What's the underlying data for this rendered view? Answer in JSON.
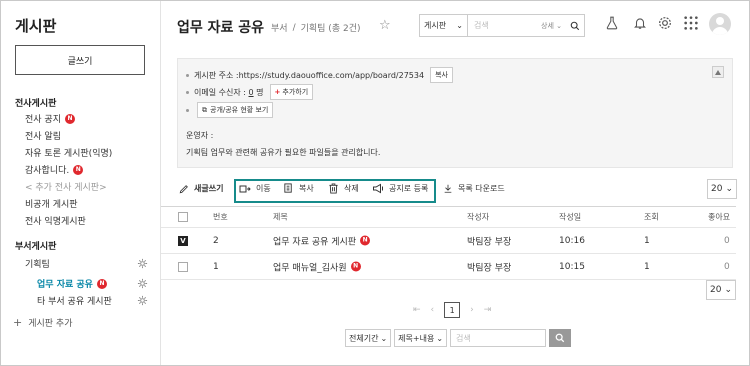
{
  "sidebar": {
    "title": "게시판",
    "write_label": "글쓰기",
    "company_section": "전사게시판",
    "company_items": [
      {
        "label": "전사 공지",
        "badge": "N"
      },
      {
        "label": "전사 알림"
      },
      {
        "label": "자유 토론 게시판(익명)"
      },
      {
        "label": "감사합니다.",
        "badge": "N"
      },
      {
        "label": "< 추가 전사 게시판>"
      },
      {
        "label": "비공개 게시판"
      },
      {
        "label": "전사 익명게시판"
      }
    ],
    "dept_section": "부서게시판",
    "dept_items": [
      {
        "label": "기획팀"
      },
      {
        "label": "업무 자료 공유",
        "badge": "N"
      },
      {
        "label": "타 부서 공유 게시판"
      }
    ],
    "add_label": "게시판 추가"
  },
  "header": {
    "title": "업무 자료 공유",
    "crumb_1": "부서",
    "crumb_sep": "/",
    "crumb_2": "기획팀 (총 2건)",
    "search_select": "게시판",
    "search_placeholder": "검색",
    "search_detail": "상세"
  },
  "info": {
    "address_label": "게시판 주소 :",
    "address_value": "https://study.daouoffice.com/app/board/27534",
    "copy_label": "복사",
    "email_label": "이메일 수신자 :",
    "email_count": "0",
    "email_unit": "명",
    "add_label": "추가하기",
    "share_label": "공개/공유 현황 보기",
    "operator_label": "운영자 :",
    "description": "기획팀 업무와 관련해 공유가 필요한 파일들을 관리합니다."
  },
  "toolbar": {
    "write": "새글쓰기",
    "move": "이동",
    "copy": "복사",
    "delete": "삭제",
    "notice": "공지로 등록",
    "download": "목록 다운로드",
    "page_size": "20"
  },
  "table": {
    "headers": {
      "no": "번호",
      "title": "제목",
      "author": "작성자",
      "date": "작성일",
      "views": "조회",
      "likes": "좋아요"
    },
    "rows": [
      {
        "no": "2",
        "title": "업무 자료 공유 게시판",
        "badge": "N",
        "author": "박팀장 부장",
        "date": "10:16",
        "views": "1",
        "likes": "0",
        "checked": true
      },
      {
        "no": "1",
        "title": "업무 매뉴얼_김사원",
        "badge": "N",
        "author": "박팀장 부장",
        "date": "10:15",
        "views": "1",
        "likes": "0",
        "checked": false
      }
    ]
  },
  "pager": {
    "current": "1"
  },
  "bottom_search": {
    "period": "전체기간",
    "field": "제목+내용",
    "placeholder": "검색"
  },
  "colors": {
    "accent": "#168b8b",
    "badge": "#e0282e",
    "active": "#0a88a8"
  }
}
